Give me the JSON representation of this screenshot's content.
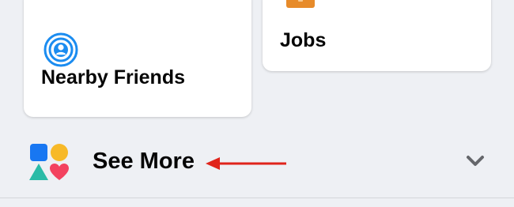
{
  "shortcuts": {
    "nearby_friends": {
      "label": "Nearby Friends",
      "icon": "nearby-friends-icon"
    },
    "jobs": {
      "label": "Jobs",
      "icon": "briefcase-icon"
    }
  },
  "see_more": {
    "label": "See More",
    "icon": "shapes-icon",
    "expand_icon": "chevron-down-icon"
  },
  "annotation": {
    "icon": "red-arrow-icon",
    "color": "#e0241b"
  },
  "colors": {
    "background": "#eef0f4",
    "card": "#ffffff",
    "text": "#050505",
    "nearby_blue": "#1b8cf0",
    "jobs_orange": "#e78b2a",
    "shape_blue": "#1877f2",
    "shape_yellow": "#f7b928",
    "shape_teal": "#2abba7",
    "shape_pink": "#f3425f",
    "chevron": "#65676b"
  }
}
